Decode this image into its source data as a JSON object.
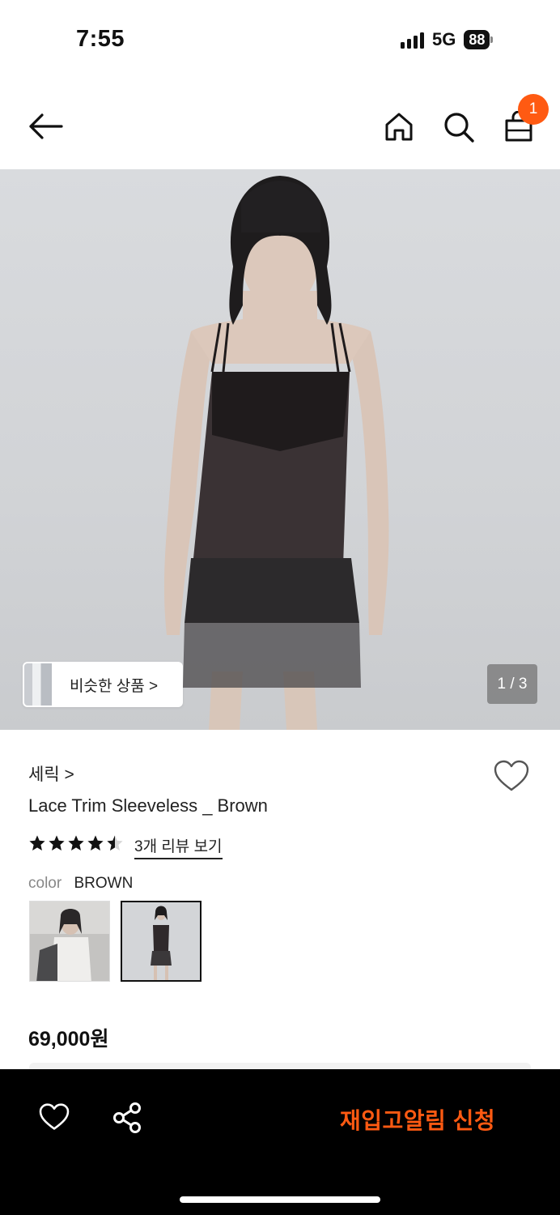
{
  "status_bar": {
    "time": "7:55",
    "network": "5G",
    "battery": "88",
    "icons": [
      "signal-icon",
      "battery-icon"
    ]
  },
  "header": {
    "icons": [
      "back-arrow-icon",
      "home-icon",
      "search-icon",
      "shopping-bag-icon"
    ],
    "cart_count": "1",
    "accent_color": "#ff5a12"
  },
  "gallery": {
    "similar_label": "비슷한 상품 >",
    "counter": "1 / 3"
  },
  "product": {
    "brand": "세릭 >",
    "title": "Lace Trim Sleeveless _ Brown",
    "rating": 4.5,
    "rating_max": 5,
    "review_link": "3개 리뷰 보기",
    "color_label": "color",
    "color_value": "BROWN",
    "swatches": [
      "white-variant",
      "brown-variant"
    ],
    "selected_swatch": "brown-variant",
    "price": "69,000원"
  },
  "bottom_bar": {
    "icons": [
      "heart-icon",
      "share-icon"
    ],
    "cta_label": "재입고알림 신청"
  }
}
